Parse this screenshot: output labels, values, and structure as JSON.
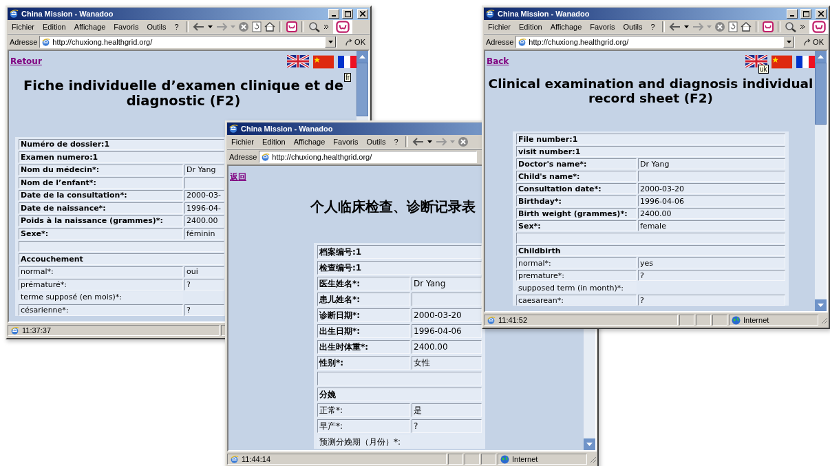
{
  "windows": [
    {
      "title": "China Mission - Wanadoo",
      "menu": [
        "Fichier",
        "Edition",
        "Affichage",
        "Favoris",
        "Outils",
        "?"
      ],
      "address_label": "Adresse",
      "url": "http://chuxiong.healthgrid.org/",
      "go_label": "OK",
      "back_link": "Retour",
      "language_flags": true,
      "flag_tooltip": "fr",
      "heading": "Fiche individuelle d’examen clinique et de diagnostic (F2)",
      "rows": [
        {
          "kind": "header",
          "label": "Numéro de dossier:1"
        },
        {
          "kind": "header",
          "label": "Examen numero:1"
        },
        {
          "kind": "field",
          "label": "Nom du médecin*:",
          "value": "Dr Yang"
        },
        {
          "kind": "field",
          "label": "Nom de l’enfant*:"
        },
        {
          "kind": "field",
          "label": "Date de la consultation*:",
          "value": "2000-03-"
        },
        {
          "kind": "field",
          "label": "Date de naissance*:",
          "value": "1996-04-"
        },
        {
          "kind": "field",
          "label": "Poids à la naissance (grammes)*:",
          "value": "2400.00"
        },
        {
          "kind": "field",
          "label": "Sexe*:",
          "value": "féminin"
        },
        {
          "kind": "blank"
        },
        {
          "kind": "section",
          "label": "Accouchement"
        },
        {
          "kind": "plain",
          "label": "normal*:",
          "value": "oui"
        },
        {
          "kind": "plain",
          "label": "prématuré*:",
          "value": "?"
        },
        {
          "kind": "open",
          "label": "terme supposé (en mois)*:"
        },
        {
          "kind": "plain",
          "label": "césarienne*:",
          "value": "?"
        }
      ],
      "status_time": "11:37:37"
    },
    {
      "title": "China Mission - Wanadoo",
      "menu": [
        "Fichier",
        "Edition",
        "Affichage",
        "Favoris",
        "Outils",
        "?"
      ],
      "address_label": "Adresse",
      "url": "http://chuxiong.healthgrid.org/",
      "back_link": "返回",
      "heading": "个人临床检查、诊断记录表",
      "rows": [
        {
          "kind": "header",
          "label": "档案编号:1"
        },
        {
          "kind": "header",
          "label": "检查编号:1"
        },
        {
          "kind": "field",
          "label": "医生姓名*:",
          "value": "Dr Yang"
        },
        {
          "kind": "field",
          "label": "患儿姓名*:"
        },
        {
          "kind": "field",
          "label": "诊断日期*:",
          "value": "2000-03-20"
        },
        {
          "kind": "field",
          "label": "出生日期*:",
          "value": "1996-04-06"
        },
        {
          "kind": "field",
          "label": "出生时体重*:",
          "value": "2400.00"
        },
        {
          "kind": "field",
          "label": "性别*:",
          "value": "女性"
        },
        {
          "kind": "blank"
        },
        {
          "kind": "section",
          "label": "分娩"
        },
        {
          "kind": "plain",
          "label": "正常*:",
          "value": "是"
        },
        {
          "kind": "plain",
          "label": "早产*:",
          "value": "?"
        },
        {
          "kind": "open",
          "label": "预测分娩期（月份）*:"
        }
      ],
      "status_time": "11:44:14",
      "status_zone": "Internet"
    },
    {
      "title": "China Mission - Wanadoo",
      "menu": [
        "Fichier",
        "Edition",
        "Affichage",
        "Favoris",
        "Outils",
        "?"
      ],
      "address_label": "Adresse",
      "url": "http://chuxiong.healthgrid.org/",
      "go_label": "OK",
      "back_link": "Back",
      "language_flags": true,
      "flag_tooltip": "uk",
      "heading": "Clinical examination and diagnosis individual record sheet (F2)",
      "rows": [
        {
          "kind": "header",
          "label": "File number:1"
        },
        {
          "kind": "header",
          "label": "visit number:1"
        },
        {
          "kind": "field",
          "label": "Doctor's name*:",
          "value": "Dr Yang"
        },
        {
          "kind": "field",
          "label": "Child's name*:"
        },
        {
          "kind": "field",
          "label": "Consultation date*:",
          "value": "2000-03-20"
        },
        {
          "kind": "field",
          "label": "Birthday*:",
          "value": "1996-04-06"
        },
        {
          "kind": "field",
          "label": "Birth weight (grammes)*:",
          "value": "2400.00"
        },
        {
          "kind": "field",
          "label": "Sex*:",
          "value": "female"
        },
        {
          "kind": "blank"
        },
        {
          "kind": "section",
          "label": "Childbirth"
        },
        {
          "kind": "plain",
          "label": "normal*:",
          "value": "yes"
        },
        {
          "kind": "plain",
          "label": "premature*:",
          "value": "?"
        },
        {
          "kind": "open",
          "label": "supposed term (in month)*:"
        },
        {
          "kind": "plain",
          "label": "caesarean*:",
          "value": "?"
        }
      ],
      "status_time": "11:41:52",
      "status_zone": "Internet"
    }
  ]
}
